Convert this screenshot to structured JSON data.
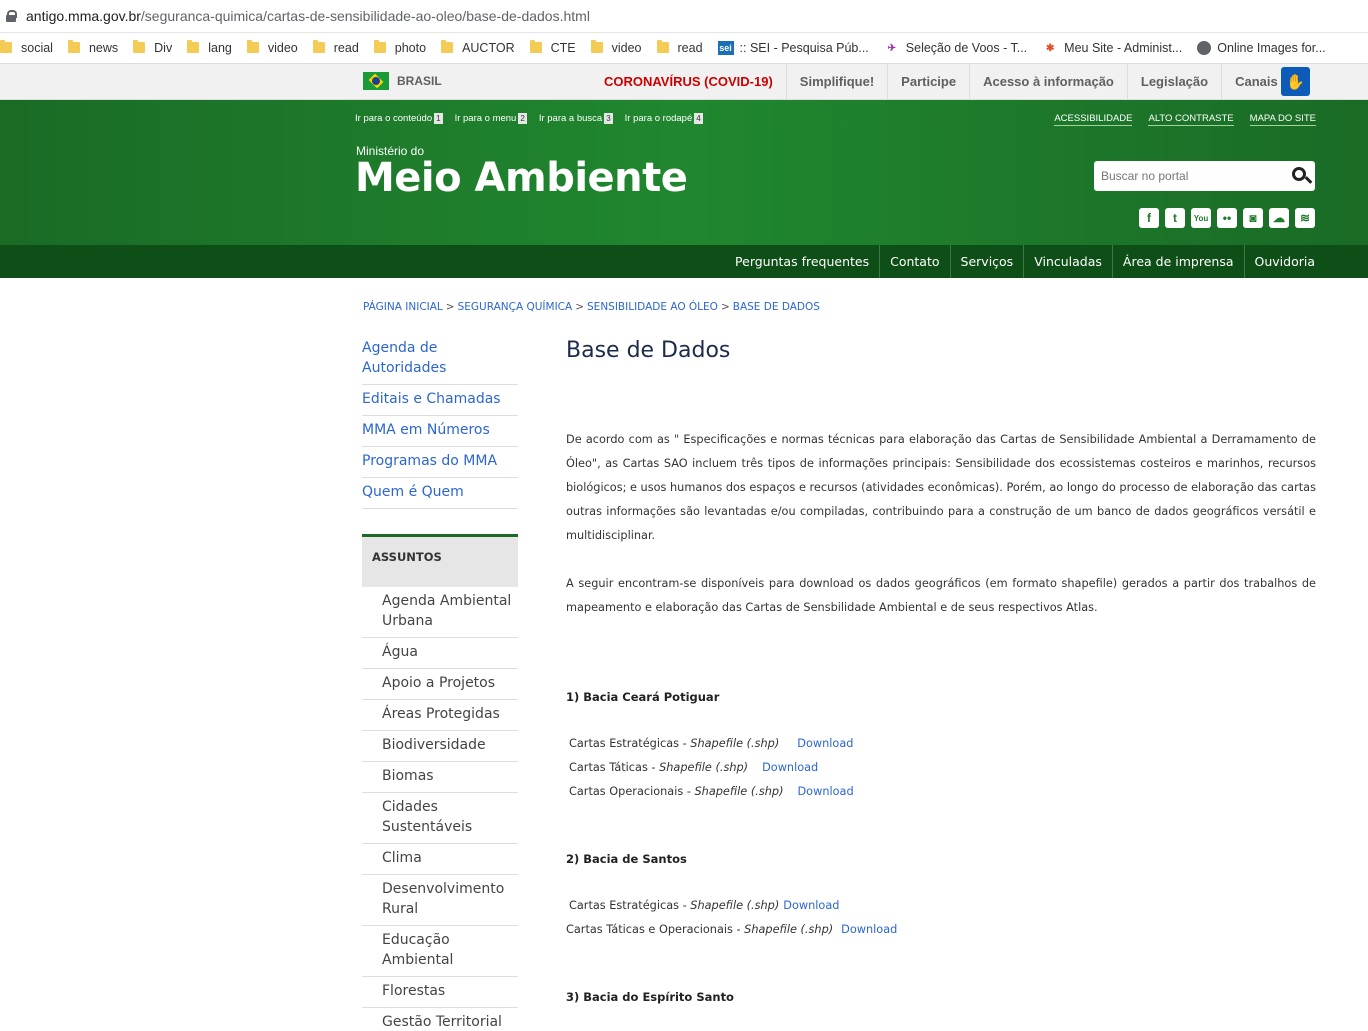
{
  "browser": {
    "url_host": "antigo.mma.gov.br",
    "url_path": "/seguranca-quimica/cartas-de-sensibilidade-ao-oleo/base-de-dados.html",
    "bookmarks": [
      "social",
      "news",
      "Div",
      "lang",
      "video",
      "read",
      "photo",
      "AUCTOR",
      "CTE",
      "video",
      "read"
    ],
    "bookmark_sei": ":: SEI - Pesquisa Púb...",
    "bookmark_voos": "Seleção de Voos - T...",
    "bookmark_site": "Meu Site - Administ...",
    "bookmark_images": "Online Images for..."
  },
  "govbar": {
    "brasil": "BRASIL",
    "links": [
      "CORONAVÍRUS (COVID-19)",
      "Simplifique!",
      "Participe",
      "Acesso à informação",
      "Legislação",
      "Canais"
    ]
  },
  "header": {
    "skip_links": [
      {
        "label": "Ir para o conteúdo",
        "num": "1"
      },
      {
        "label": "Ir para o menu",
        "num": "2"
      },
      {
        "label": "Ir para a busca",
        "num": "3"
      },
      {
        "label": "Ir para o rodapé",
        "num": "4"
      }
    ],
    "top_links": [
      "ACESSIBILIDADE",
      "ALTO CONTRASTE",
      "MAPA DO SITE"
    ],
    "subtitle": "Ministério do",
    "title": "Meio Ambiente",
    "search_placeholder": "Buscar no portal",
    "social": [
      "f",
      "t",
      "You",
      "••",
      "◙",
      "☁",
      "≋"
    ]
  },
  "nav": [
    "Perguntas frequentes",
    "Contato",
    "Serviços",
    "Vinculadas",
    "Área de imprensa",
    "Ouvidoria"
  ],
  "breadcrumb": [
    "PÁGINA INICIAL",
    "SEGURANÇA QUÍMICA",
    "SENSIBILIDADE AO ÓLEO",
    "BASE DE DADOS"
  ],
  "sidebar": {
    "items": [
      "Agenda de Autoridades",
      "Editais e Chamadas",
      "MMA em Números",
      "Programas do MMA",
      "Quem é Quem"
    ],
    "assuntos_title": "ASSUNTOS",
    "assuntos": [
      "Agenda Ambiental Urbana",
      "Água",
      "Apoio a Projetos",
      "Áreas Protegidas",
      "Biodiversidade",
      "Biomas",
      "Cidades Sustentáveis",
      "Clima",
      "Desenvolvimento Rural",
      "Educação Ambiental",
      "Florestas",
      "Gestão Territorial"
    ]
  },
  "main": {
    "title": "Base de Dados",
    "para1": "De acordo com as \" Especificações e normas técnicas para elaboração das Cartas de Sensibilidade Ambiental a Derramamento de Óleo\",  as Cartas SAO incluem três tipos de informações principais: Sensibilidade dos ecossistemas costeiros e marinhos, recursos biológicos; e usos humanos dos espaços e recursos (atividades econômicas). Porém, ao longo do processo de elaboração das cartas outras informações são levantadas e/ou compiladas, contribuindo para a construção de um banco de dados geográficos versátil e multidisciplinar.",
    "para2": "A seguir encontram-se disponíveis para download os dados geográficos (em formato shapefile) gerados a partir dos trabalhos de mapeamento e elaboração das Cartas de Sensbilidade Ambiental e de seus respectivos Atlas.",
    "download_label": "Download",
    "shapefile_label": "Shapefile (.shp)",
    "sections": [
      {
        "title": "1) Bacia Ceará Potiguar",
        "rows": [
          "Cartas Estratégicas - ",
          "Cartas Táticas  - ",
          "Cartas Operacionais - "
        ]
      },
      {
        "title": "2) Bacia de Santos",
        "rows": [
          "Cartas Estratégicas - ",
          "Cartas Táticas e Operacionais - "
        ]
      },
      {
        "title": "3) Bacia do Espírito Santo",
        "rows": []
      }
    ]
  }
}
